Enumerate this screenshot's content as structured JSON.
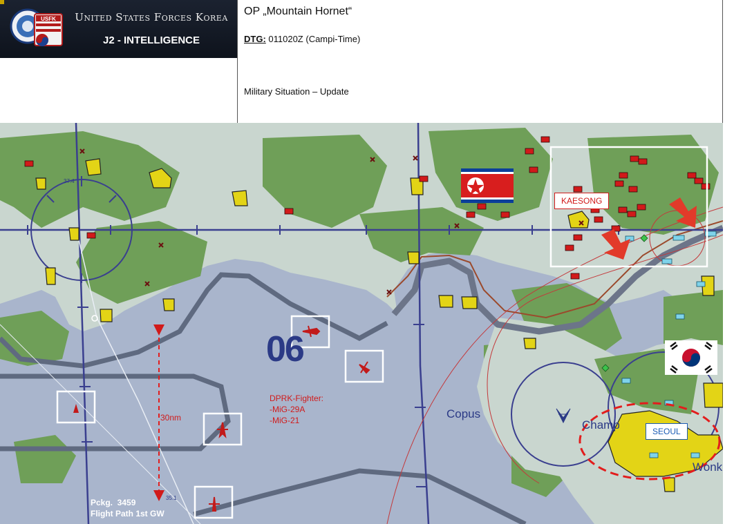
{
  "header": {
    "org_title": "United States Forces Korea",
    "section": "J2 - INTELLIGENCE",
    "emblem_text": "USFK"
  },
  "briefing": {
    "op_name": "OP „Mountain Hornet“",
    "dtg_label": "DTG:",
    "dtg_value": " 011020Z (Campi-Time)",
    "subtitle": "Military Situation – Update"
  },
  "map": {
    "labels": {
      "kaesong": "KAESONG",
      "seoul": "SEOUL",
      "distance": "30nm",
      "copus": "Copus",
      "champ": "Champ",
      "wonk": "Wonk",
      "grid_number": "06",
      "lat_top": "37.4",
      "lat_bottom": "35.1"
    },
    "threat_note": [
      "DPRK-Fighter:",
      "-MiG-29A",
      "-MiG-21"
    ],
    "package_note": [
      "Pckg.  3459",
      "Flight Path 1st GW"
    ],
    "colors": {
      "sea": "#a9b5cc",
      "land": "#c8d6cf",
      "forest": "#6e9e56",
      "threat_red": "#d11a1a",
      "friendly_yellow": "#e3d416",
      "route_blue": "#3a3f8f"
    }
  }
}
